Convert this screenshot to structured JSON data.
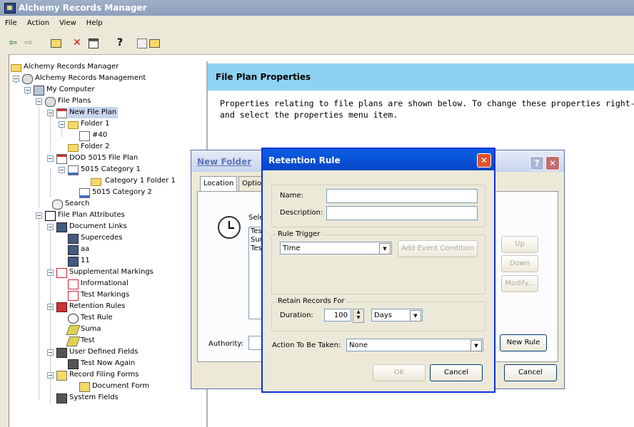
{
  "window": {
    "title": "Alchemy Records Manager",
    "title_icon": "alchemy-app-icon"
  },
  "menu": [
    "File",
    "Action",
    "View",
    "Help"
  ],
  "toolbar": {
    "icons": [
      "back-arrow-icon",
      "forward-arrow-icon",
      "up-folder-icon",
      "delete-icon",
      "properties-icon",
      "help-icon",
      "show-hide-tree-icon",
      "new-folder-icon"
    ]
  },
  "tree": {
    "nodes": [
      "Alchemy Records Manager",
      "Alchemy Records Management",
      "My Computer",
      "File Plans",
      "New File Plan",
      "Folder 1",
      "#40",
      "Folder 2",
      "DOD 5015 File Plan",
      "5015 Category 1",
      "Category 1 Folder 1",
      "5015 Category 2",
      "Search",
      "File Plan Attributes",
      "Document Links",
      "Supercedes",
      "aa",
      "11",
      "Supplemental Markings",
      "Informational",
      "Test Markings",
      "Retention Rules",
      "Test Rule",
      "Suma",
      "Test",
      "User Defined Fields",
      "Test Now Again",
      "Record Filing Forms",
      "Document Form",
      "System Fields"
    ]
  },
  "right": {
    "header": "File Plan Properties",
    "desc_line1": "Properties relating to file plans are shown below. To change these properties right-clic",
    "desc_line2": "and select the properties menu item."
  },
  "new_folder_dialog": {
    "title": "New Folder",
    "tabs": [
      "Location",
      "Optio"
    ],
    "select_label": "Sele",
    "list_items": [
      "Tes",
      "Sur",
      "Tes"
    ],
    "buttons": {
      "up": "Up",
      "down": "Down",
      "modify": "Modify...",
      "new_rule": "New Rule",
      "cancel": "Cancel"
    },
    "authority_label": "Authority:"
  },
  "retention_dialog": {
    "title": "Retention Rule",
    "name_label": "Name:",
    "name_value": "",
    "description_label": "Description:",
    "description_value": "",
    "rule_trigger_group": "Rule Trigger",
    "trigger_value": "Time",
    "add_event_button": "Add Event Condition",
    "retain_group": "Retain Records For",
    "duration_label": "Duration:",
    "duration_value": "100",
    "duration_unit": "Days",
    "action_label": "Action To Be Taken:",
    "action_value": "None",
    "ok_button": "OK",
    "cancel_button": "Cancel"
  }
}
